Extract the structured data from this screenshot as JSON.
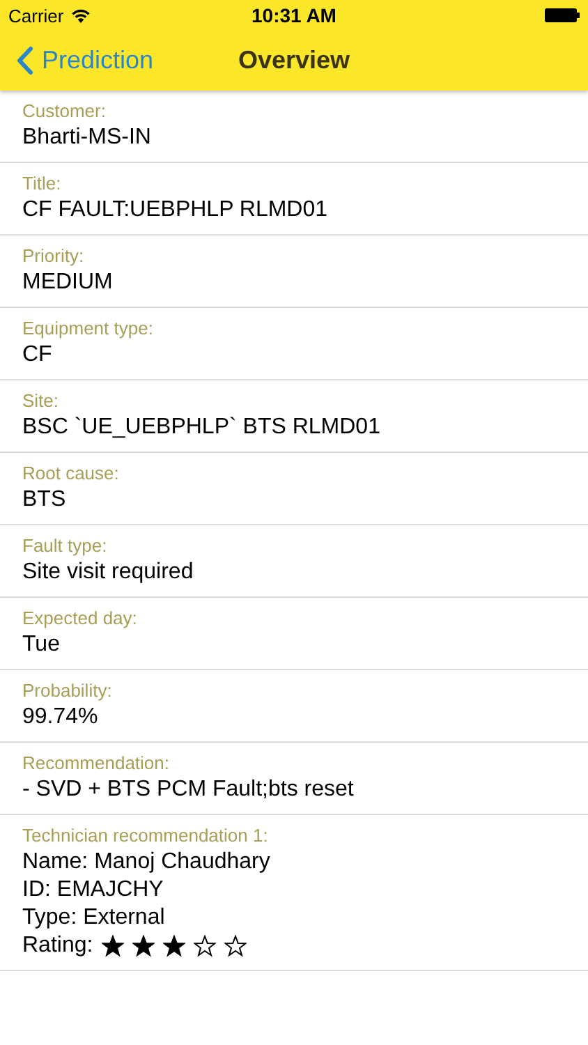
{
  "status_bar": {
    "carrier": "Carrier",
    "time": "10:31 AM"
  },
  "nav_bar": {
    "back_label": "Prediction",
    "title": "Overview"
  },
  "fields": [
    {
      "label": "Customer:",
      "value": "Bharti-MS-IN"
    },
    {
      "label": "Title:",
      "value": "CF FAULT:UEBPHLP RLMD01"
    },
    {
      "label": "Priority:",
      "value": "MEDIUM"
    },
    {
      "label": "Equipment type:",
      "value": "CF"
    },
    {
      "label": "Site:",
      "value": "BSC `UE_UEBPHLP` BTS RLMD01"
    },
    {
      "label": "Root cause:",
      "value": "BTS"
    },
    {
      "label": "Fault type:",
      "value": "Site visit required"
    },
    {
      "label": "Expected day:",
      "value": "Tue"
    },
    {
      "label": "Probability:",
      "value": "99.74%"
    },
    {
      "label": "Recommendation:",
      "value": "- SVD + BTS PCM Fault;bts reset"
    }
  ],
  "technician": {
    "label": "Technician recommendation 1:",
    "lines": [
      "Name: Manoj Chaudhary",
      "ID: EMAJCHY",
      "Type: External"
    ],
    "rating_label": "Rating:",
    "stars": 3
  }
}
